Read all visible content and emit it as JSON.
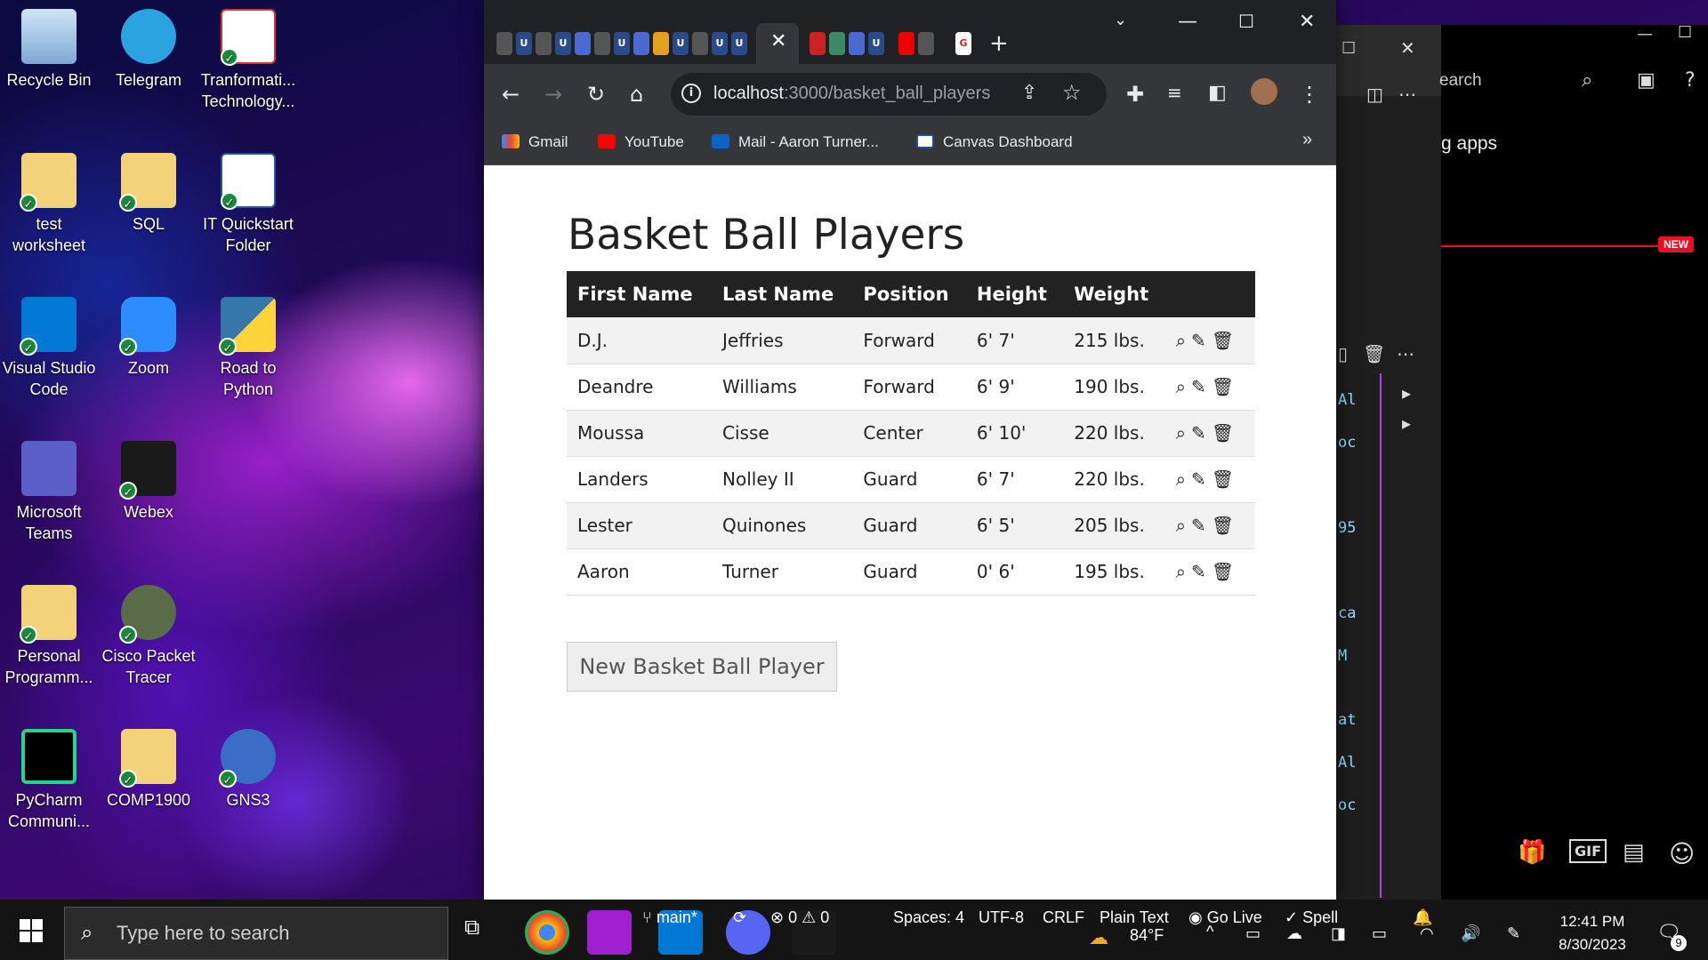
{
  "desktop": {
    "icons": [
      {
        "label": "Recycle Bin",
        "icon": "recycle-bin-icon"
      },
      {
        "label": "Telegram",
        "icon": "telegram-icon"
      },
      {
        "label": "Tranformati... Technology...",
        "icon": "pdf-file-icon"
      },
      {
        "label": "test worksheet",
        "icon": "folder-icon"
      },
      {
        "label": "SQL",
        "icon": "folder-icon"
      },
      {
        "label": "IT Quickstart Folder",
        "icon": "word-doc-icon"
      },
      {
        "label": "Visual Studio Code",
        "icon": "vscode-icon"
      },
      {
        "label": "Zoom",
        "icon": "zoom-icon"
      },
      {
        "label": "Road to Python",
        "icon": "python-icon"
      },
      {
        "label": "Microsoft Teams",
        "icon": "teams-icon"
      },
      {
        "label": "Webex",
        "icon": "webex-icon"
      },
      {
        "label": "Personal Programm...",
        "icon": "folder-icon"
      },
      {
        "label": "Cisco Packet Tracer",
        "icon": "packet-tracer-icon"
      },
      {
        "label": "PyCharm Communi...",
        "icon": "pycharm-icon"
      },
      {
        "label": "COMP1900",
        "icon": "folder-icon"
      },
      {
        "label": "GNS3",
        "icon": "gns3-icon"
      }
    ]
  },
  "background_app": {
    "search_text": "earch",
    "apps_text": "g apps",
    "new_badge": "NEW",
    "code_fragments": [
      "Al",
      "oc",
      "95",
      "ca",
      "M",
      "at",
      "Al",
      "oc"
    ],
    "chat_icons": [
      "gift-icon",
      "GIF",
      "sticker-icon",
      "emoji-icon"
    ]
  },
  "browser": {
    "url_host": "localhost",
    "url_path": ":3000/basket_ball_players",
    "bookmarks": [
      {
        "label": "Gmail",
        "icon": "gmail-icon"
      },
      {
        "label": "YouTube",
        "icon": "youtube-icon"
      },
      {
        "label": "Mail - Aaron Turner...",
        "icon": "outlook-icon"
      },
      {
        "label": "Canvas Dashboard",
        "icon": "canvas-icon"
      }
    ],
    "bookmarks_overflow": "»"
  },
  "page": {
    "title": "Basket Ball Players",
    "columns": [
      "First Name",
      "Last Name",
      "Position",
      "Height",
      "Weight"
    ],
    "rows": [
      {
        "first": "D.J.",
        "last": "Jeffries",
        "position": "Forward",
        "height": "6' 7'",
        "weight": "215 lbs."
      },
      {
        "first": "Deandre",
        "last": "Williams",
        "position": "Forward",
        "height": "6' 9'",
        "weight": "190 lbs."
      },
      {
        "first": "Moussa",
        "last": "Cisse",
        "position": "Center",
        "height": "6' 10'",
        "weight": "220 lbs."
      },
      {
        "first": "Landers",
        "last": "Nolley II",
        "position": "Guard",
        "height": "6' 7'",
        "weight": "220 lbs."
      },
      {
        "first": "Lester",
        "last": "Quinones",
        "position": "Guard",
        "height": "6' 5'",
        "weight": "205 lbs."
      },
      {
        "first": "Aaron",
        "last": "Turner",
        "position": "Guard",
        "height": "0' 6'",
        "weight": "195 lbs."
      }
    ],
    "new_button": "New Basket Ball Player"
  },
  "taskbar": {
    "search_placeholder": "Type here to search",
    "branch": "main*",
    "errors": "0",
    "warnings": "0",
    "spaces": "Spaces: 4",
    "encoding": "UTF-8",
    "eol": "CRLF",
    "language": "Plain Text",
    "go_live": "Go Live",
    "spell": "Spell",
    "temperature": "84°F",
    "time": "12:41 PM",
    "date": "8/30/2023",
    "notifications": "9"
  }
}
